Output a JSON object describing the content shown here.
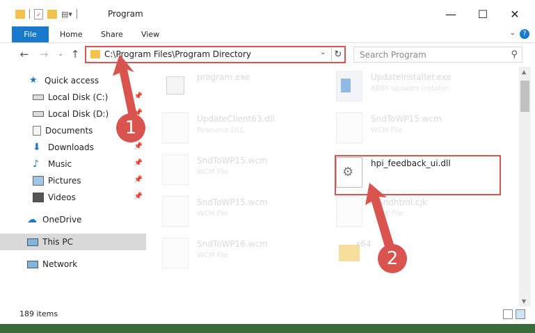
{
  "window": {
    "title": "Program"
  },
  "ribbon": {
    "tabs": [
      "File",
      "Home",
      "Share",
      "View"
    ]
  },
  "address": {
    "path": "C:\\Program Files\\Program Directory"
  },
  "search": {
    "placeholder": "Search Program"
  },
  "nav": {
    "items": [
      {
        "label": "Quick access",
        "icon": "star-icon",
        "pinned": false
      },
      {
        "label": "Local Disk (C:)",
        "icon": "drive-icon",
        "pinned": true
      },
      {
        "label": "Local Disk (D:)",
        "icon": "drive-icon",
        "pinned": true
      },
      {
        "label": "Documents",
        "icon": "documents-icon",
        "pinned": true
      },
      {
        "label": "Downloads",
        "icon": "download-icon",
        "pinned": true
      },
      {
        "label": "Music",
        "icon": "music-icon",
        "pinned": true
      },
      {
        "label": "Pictures",
        "icon": "pictures-icon",
        "pinned": true
      },
      {
        "label": "Videos",
        "icon": "videos-icon",
        "pinned": true
      },
      {
        "label": "OneDrive",
        "icon": "cloud-icon",
        "pinned": false
      },
      {
        "label": "This PC",
        "icon": "computer-icon",
        "pinned": false
      },
      {
        "label": "Network",
        "icon": "network-icon",
        "pinned": false
      }
    ]
  },
  "files": [
    {
      "name": "program.exe",
      "type": ""
    },
    {
      "name": "UpdateInstaller.exe",
      "type": "ABBY updates installer"
    },
    {
      "name": "UpdateClient63.dll",
      "type": "Resource DLL"
    },
    {
      "name": "SndToWP15.wcm",
      "type": "WCM File"
    },
    {
      "name": "SndToWP15.wcm",
      "type": "WCM File"
    },
    {
      "name": "hpi_feedback_ui.dll",
      "type": ""
    },
    {
      "name": "SndToWP15.wcm",
      "type": "WCM File"
    },
    {
      "name": "Sndhtml.cjk",
      "type": "CJK File"
    },
    {
      "name": "SndToWP16.wcm",
      "type": "WCM File"
    },
    {
      "name": "x64",
      "type": ""
    }
  ],
  "status": {
    "count": "189 items"
  },
  "annotations": {
    "badge1": "1",
    "badge2": "2"
  },
  "colors": {
    "accent": "#1979ca",
    "annotation": "#d9534f"
  }
}
